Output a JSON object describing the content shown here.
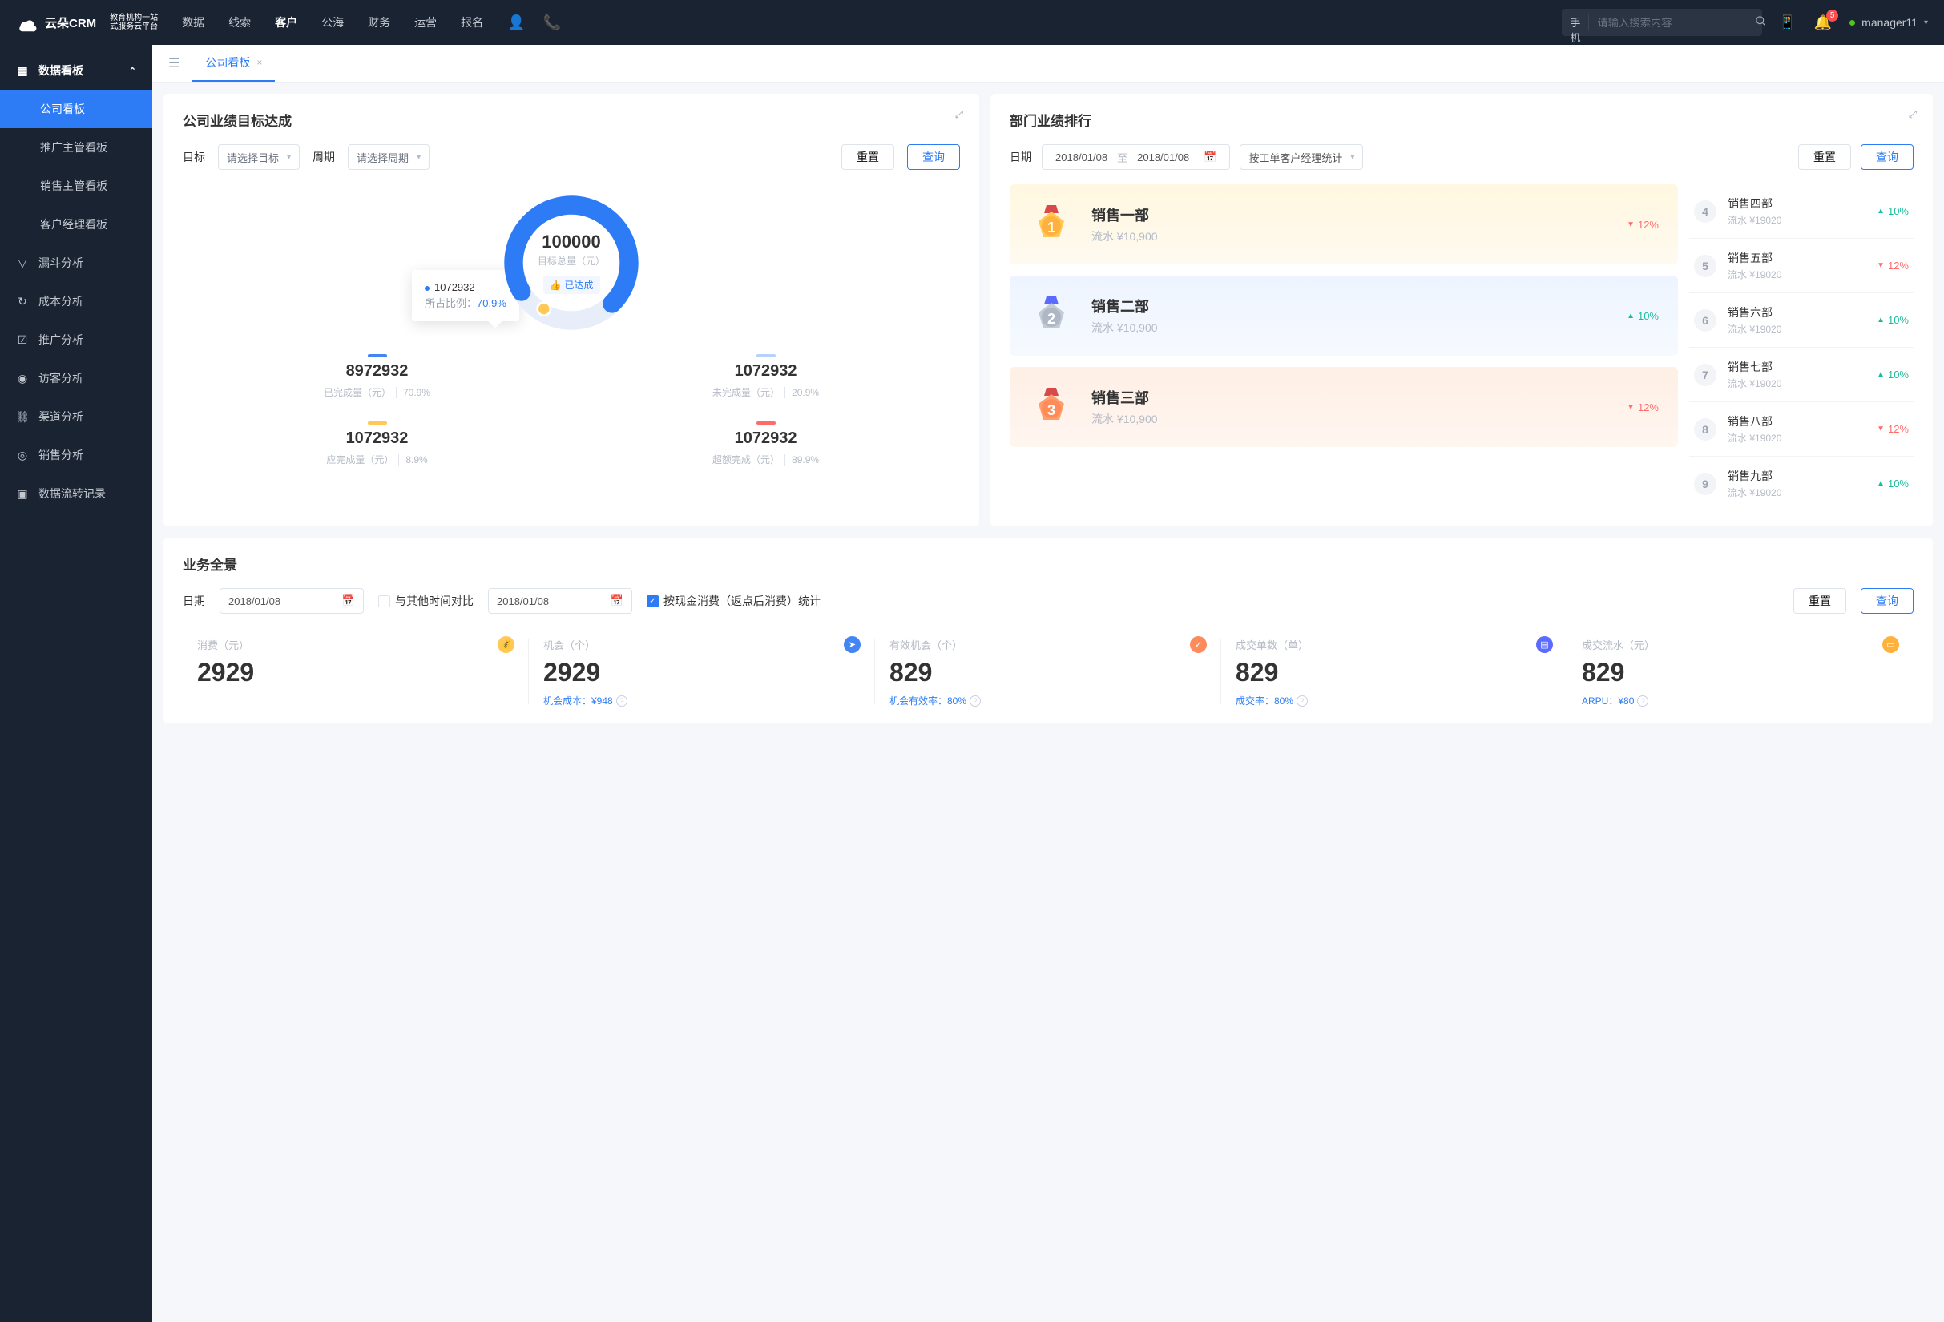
{
  "logo": {
    "brand": "云朵CRM",
    "sub1": "教育机构一站",
    "sub2": "式服务云平台"
  },
  "topmenu": {
    "data": "数据",
    "leads": "线索",
    "customer": "客户",
    "sea": "公海",
    "finance": "财务",
    "ops": "运营",
    "signup": "报名"
  },
  "search": {
    "type": "手机号码",
    "placeholder": "请输入搜索内容"
  },
  "notif_count": "5",
  "user": {
    "name": "manager11"
  },
  "sidebar": {
    "header": "数据看板",
    "items": [
      "公司看板",
      "推广主管看板",
      "销售主管看板",
      "客户经理看板"
    ],
    "menu": {
      "funnel": "漏斗分析",
      "cost": "成本分析",
      "promo": "推广分析",
      "visitor": "访客分析",
      "channel": "渠道分析",
      "sales": "销售分析",
      "flow": "数据流转记录"
    }
  },
  "tab": {
    "name": "公司看板"
  },
  "target": {
    "title": "公司业绩目标达成",
    "filters": {
      "goal_label": "目标",
      "goal_ph": "请选择目标",
      "period_label": "周期",
      "period_ph": "请选择周期",
      "reset": "重置",
      "query": "查询"
    },
    "total": "100000",
    "total_label": "目标总量（元）",
    "badge": "已达成",
    "tooltip": {
      "val": "1072932",
      "lbl": "所占比例：",
      "pct": "70.9%"
    },
    "stats": [
      {
        "num": "8972932",
        "lbl": "已完成量（元）",
        "pct": "70.9%"
      },
      {
        "num": "1072932",
        "lbl": "未完成量（元）",
        "pct": "20.9%"
      },
      {
        "num": "1072932",
        "lbl": "应完成量（元）",
        "pct": "8.9%"
      },
      {
        "num": "1072932",
        "lbl": "超额完成（元）",
        "pct": "89.9%"
      }
    ]
  },
  "dept": {
    "title": "部门业绩排行",
    "filters": {
      "date_label": "日期",
      "from": "2018/01/08",
      "to_lbl": "至",
      "to": "2018/01/08",
      "group": "按工单客户经理统计",
      "reset": "重置",
      "query": "查询"
    },
    "podium": [
      {
        "name": "销售一部",
        "amt": "流水 ¥10,900",
        "pct": "12%",
        "dir": "down"
      },
      {
        "name": "销售二部",
        "amt": "流水 ¥10,900",
        "pct": "10%",
        "dir": "up"
      },
      {
        "name": "销售三部",
        "amt": "流水 ¥10,900",
        "pct": "12%",
        "dir": "down"
      }
    ],
    "list": [
      {
        "no": "4",
        "name": "销售四部",
        "amt": "流水 ¥19020",
        "pct": "10%",
        "dir": "up"
      },
      {
        "no": "5",
        "name": "销售五部",
        "amt": "流水 ¥19020",
        "pct": "12%",
        "dir": "down"
      },
      {
        "no": "6",
        "name": "销售六部",
        "amt": "流水 ¥19020",
        "pct": "10%",
        "dir": "up"
      },
      {
        "no": "7",
        "name": "销售七部",
        "amt": "流水 ¥19020",
        "pct": "10%",
        "dir": "up"
      },
      {
        "no": "8",
        "name": "销售八部",
        "amt": "流水 ¥19020",
        "pct": "12%",
        "dir": "down"
      },
      {
        "no": "9",
        "name": "销售九部",
        "amt": "流水 ¥19020",
        "pct": "10%",
        "dir": "up"
      }
    ]
  },
  "overview": {
    "title": "业务全景",
    "filters": {
      "date_label": "日期",
      "date1": "2018/01/08",
      "compare": "与其他时间对比",
      "date2": "2018/01/08",
      "stat": "按现金消费（返点后消费）统计",
      "reset": "重置",
      "query": "查询"
    },
    "metrics": [
      {
        "lbl": "消费（元）",
        "val": "2929",
        "foot": ""
      },
      {
        "lbl": "机会（个）",
        "val": "2929",
        "foot": "机会成本：¥948"
      },
      {
        "lbl": "有效机会（个）",
        "val": "829",
        "foot": "机会有效率：80%"
      },
      {
        "lbl": "成交单数（单）",
        "val": "829",
        "foot": "成交率：80%"
      },
      {
        "lbl": "成交流水（元）",
        "val": "829",
        "foot": "ARPU：¥80"
      }
    ]
  },
  "chart_data": {
    "type": "pie",
    "title": "目标达成",
    "total": 100000,
    "series": [
      {
        "name": "已完成量（元）",
        "value": 8972932,
        "pct": 70.9,
        "color": "#4285f4"
      },
      {
        "name": "未完成量（元）",
        "value": 1072932,
        "pct": 20.9,
        "color": "#b7d1ff"
      },
      {
        "name": "应完成量（元）",
        "value": 1072932,
        "pct": 8.9,
        "color": "#ffc857"
      },
      {
        "name": "超额完成（元）",
        "value": 1072932,
        "pct": 89.9,
        "color": "#ff6b6b"
      }
    ]
  }
}
